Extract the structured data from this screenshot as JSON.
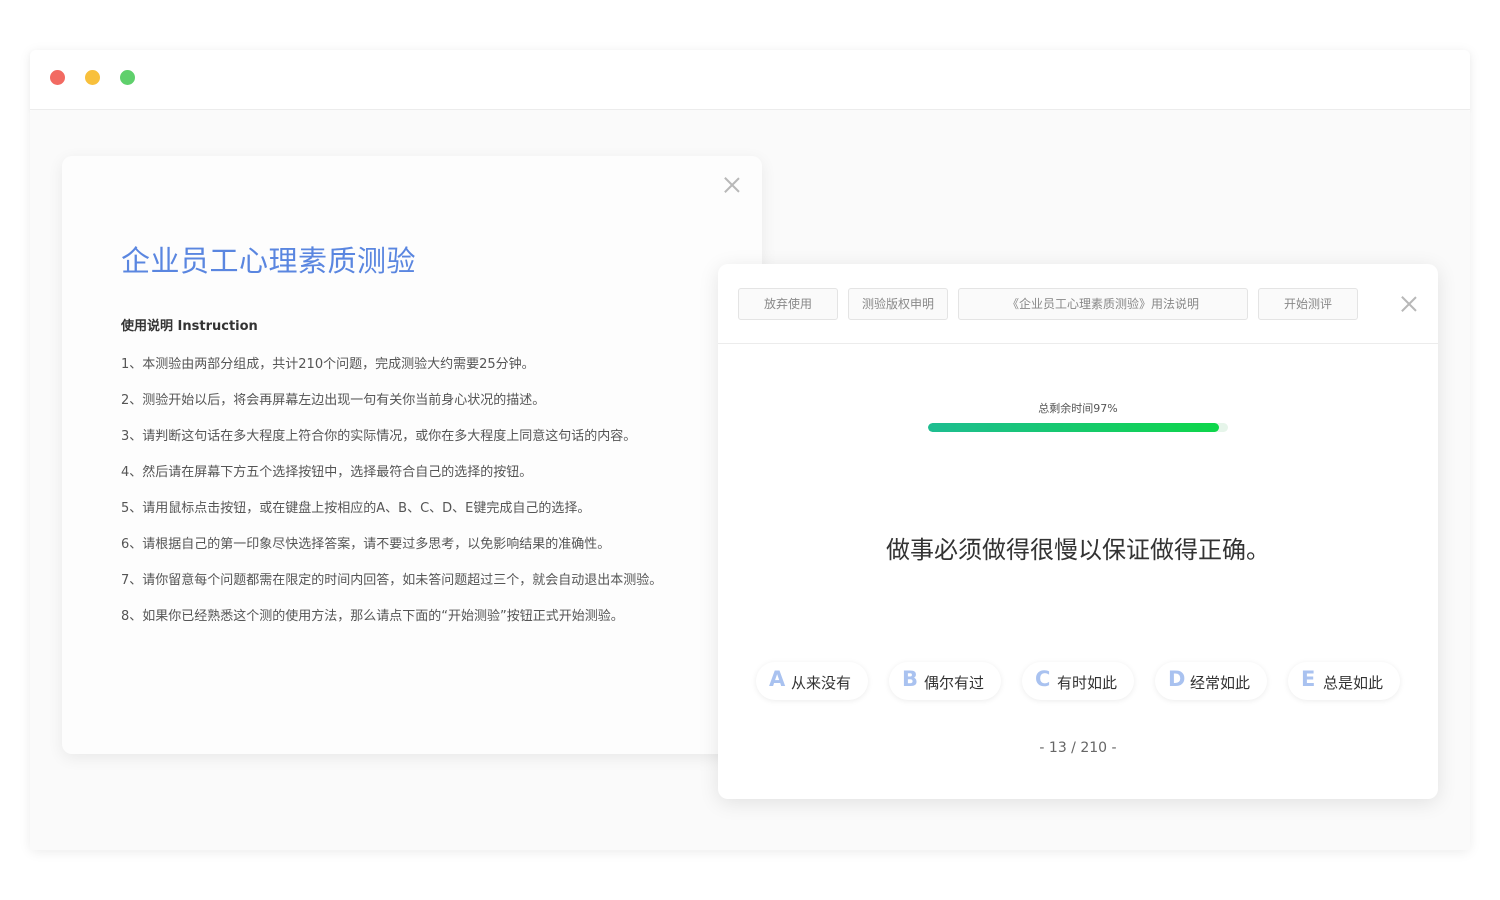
{
  "window": {
    "controls": [
      "close",
      "minimize",
      "maximize"
    ]
  },
  "intro": {
    "title": "企业员工心理素质测验",
    "subtitle": "使用说明 Instruction",
    "items": [
      "1、本测验由两部分组成，共计210个问题，完成测验大约需要25分钟。",
      "2、测验开始以后，将会再屏幕左边出现一句有关你当前身心状况的描述。",
      "3、请判断这句话在多大程度上符合你的实际情况，或你在多大程度上同意这句话的内容。",
      "4、然后请在屏幕下方五个选择按钮中，选择最符合自己的选择的按钮。",
      "5、请用鼠标点击按钮，或在键盘上按相应的A、B、C、D、E键完成自己的选择。",
      "6、请根据自己的第一印象尽快选择答案，请不要过多思考，以免影响结果的准确性。",
      "7、请你留意每个问题都需在限定的时间内回答，如未答问题超过三个，就会自动退出本测验。",
      "8、如果你已经熟悉这个测的使用方法，那么请点下面的“开始测验”按钮正式开始测验。"
    ]
  },
  "quiz": {
    "toolbar": {
      "abandon": "放弃使用",
      "copyright": "测验版权申明",
      "usage": "《企业员工心理素质测验》用法说明",
      "start": "开始测评"
    },
    "timer_label": "总剩余时间97%",
    "timer_remaining_fraction": 0.97,
    "question": "做事必须做得很慢以保证做得正确。",
    "options": [
      {
        "letter": "A",
        "text": "从来没有"
      },
      {
        "letter": "B",
        "text": "偶尔有过"
      },
      {
        "letter": "C",
        "text": "有时如此"
      },
      {
        "letter": "D",
        "text": "经常如此"
      },
      {
        "letter": "E",
        "text": "总是如此"
      }
    ],
    "pager": "- 13 / 210 -"
  },
  "colors": {
    "title_blue": "#5a86e0",
    "option_letter": "#a9c2f0",
    "progress_start": "#1ebd91",
    "progress_end": "#0ed64a"
  }
}
